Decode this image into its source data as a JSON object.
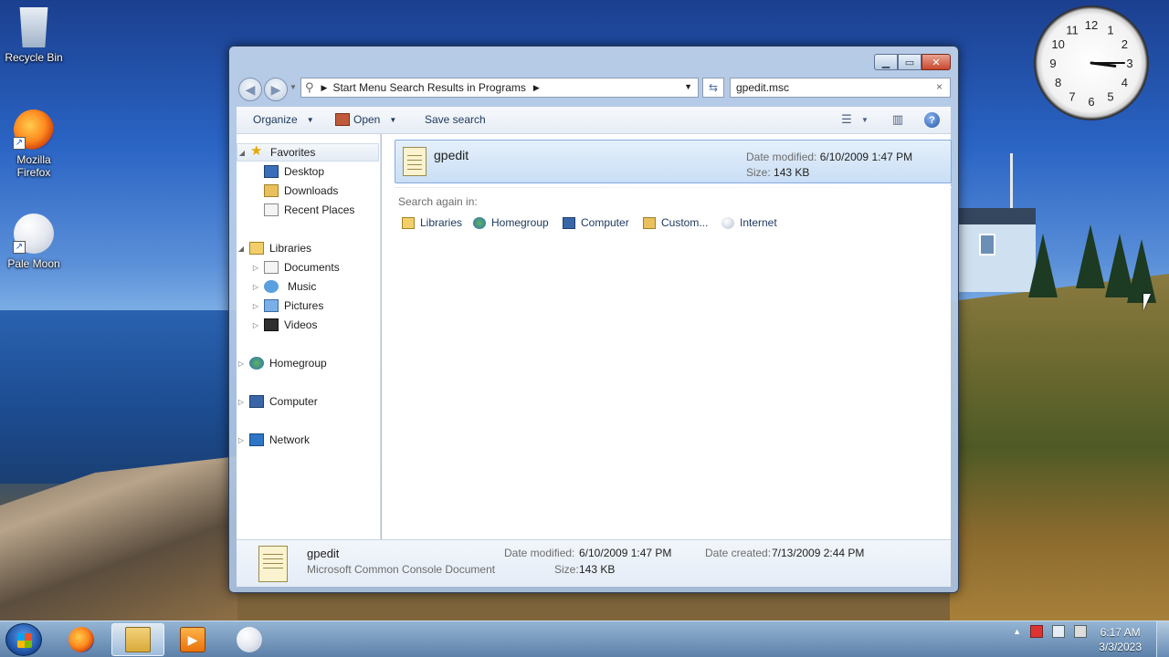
{
  "desktop": {
    "icons": [
      {
        "label": "Recycle Bin",
        "icon": "recycle-bin-icon"
      },
      {
        "label": "Mozilla Firefox",
        "icon": "firefox-icon"
      },
      {
        "label": "Pale Moon",
        "icon": "pale-moon-icon"
      }
    ]
  },
  "clock": {
    "numerals": [
      "12",
      "1",
      "2",
      "3",
      "4",
      "5",
      "6",
      "7",
      "8",
      "9",
      "10",
      "11"
    ],
    "time": "3:15"
  },
  "window": {
    "address": {
      "crumb": "Start Menu Search Results in Programs"
    },
    "search": {
      "value": "gpedit.msc",
      "clear": "×"
    },
    "toolbar": {
      "organize": "Organize",
      "open": "Open",
      "save_search": "Save search",
      "help": "?"
    },
    "nav": {
      "favorites": "Favorites",
      "desktop": "Desktop",
      "downloads": "Downloads",
      "recent": "Recent Places",
      "libraries": "Libraries",
      "documents": "Documents",
      "music": "Music",
      "pictures": "Pictures",
      "videos": "Videos",
      "homegroup": "Homegroup",
      "computer": "Computer",
      "network": "Network"
    },
    "result": {
      "name": "gpedit",
      "modified_label": "Date modified:",
      "modified": "6/10/2009 1:47 PM",
      "size_label": "Size:",
      "size": "143 KB"
    },
    "search_again": {
      "label": "Search again in:",
      "locations": [
        "Libraries",
        "Homegroup",
        "Computer",
        "Custom...",
        "Internet"
      ]
    },
    "details": {
      "name": "gpedit",
      "type": "Microsoft Common Console Document",
      "modified_label": "Date modified:",
      "modified": "6/10/2009 1:47 PM",
      "size_label": "Size:",
      "size": "143 KB",
      "created_label": "Date created:",
      "created": "7/13/2009 2:44 PM"
    }
  },
  "taskbar": {
    "clock_time": "6:17 AM",
    "clock_date": "3/3/2023",
    "apps": [
      "firefox-icon",
      "explorer-icon",
      "media-player-icon",
      "pale-moon-icon"
    ]
  },
  "colors": {
    "accent": "#3a6fb8",
    "selection": "#c9def5"
  }
}
